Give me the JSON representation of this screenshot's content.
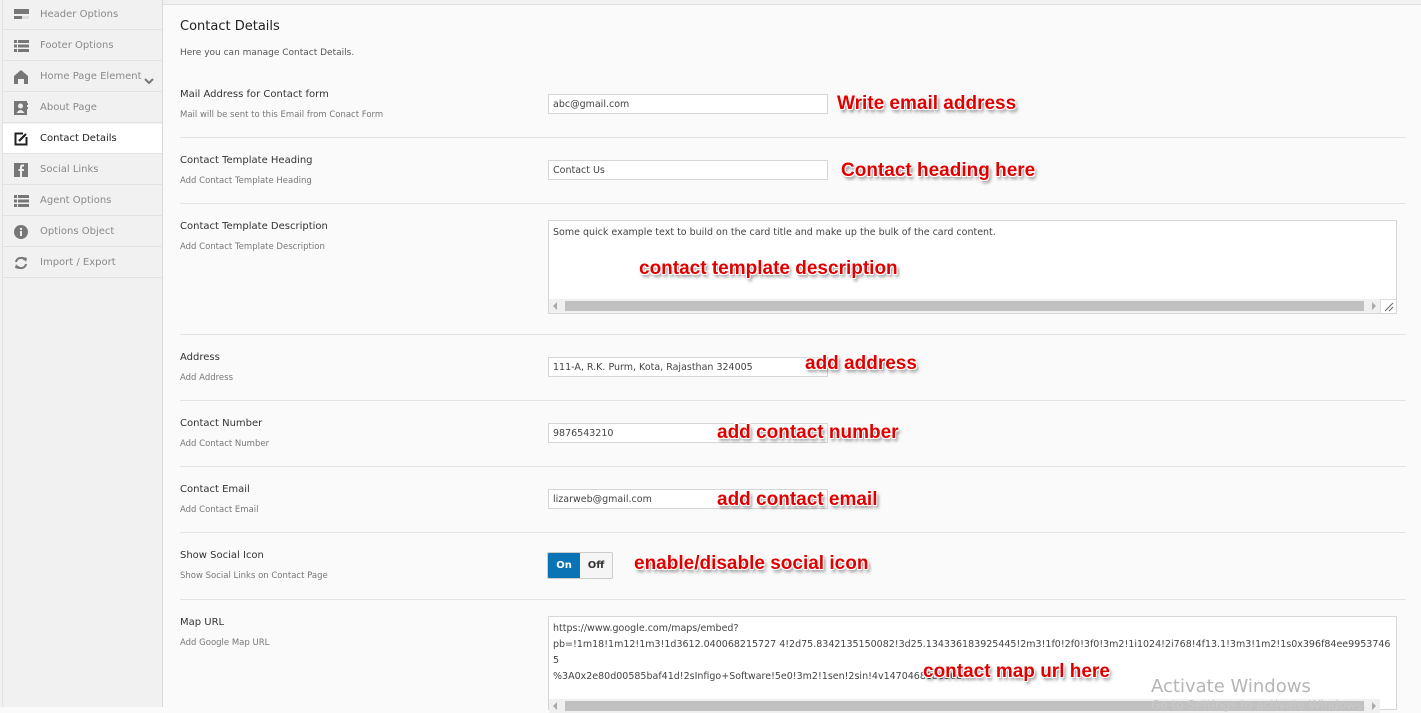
{
  "sidebar": {
    "items": [
      {
        "label": "Header Options",
        "icon": "header-icon"
      },
      {
        "label": "Footer Options",
        "icon": "list-icon"
      },
      {
        "label": "Home Page Element",
        "icon": "home-icon",
        "has_submenu": true
      },
      {
        "label": "About Page",
        "icon": "contact-card-icon"
      },
      {
        "label": "Contact Details",
        "icon": "edit-icon",
        "active": true
      },
      {
        "label": "Social Links",
        "icon": "facebook-icon"
      },
      {
        "label": "Agent Options",
        "icon": "list-icon"
      },
      {
        "label": "Options Object",
        "icon": "info-icon"
      },
      {
        "label": "Import / Export",
        "icon": "refresh-icon"
      }
    ]
  },
  "page": {
    "title": "Contact Details",
    "description": "Here you can manage Contact Details."
  },
  "fields": {
    "mail_address": {
      "label": "Mail Address for Contact form",
      "sub": "Mail will be sent to this Email from Conact Form",
      "value": "abc@gmail.com"
    },
    "template_heading": {
      "label": "Contact Template Heading",
      "sub": "Add Contact Template Heading",
      "value": "Contact Us"
    },
    "template_description": {
      "label": "Contact Template Description",
      "sub": "Add Contact Template Description",
      "value": "Some quick example text to build on the card title and make up the bulk of the card content."
    },
    "address": {
      "label": "Address",
      "sub": "Add Address",
      "value": "111-A, R.K. Purm, Kota, Rajasthan 324005"
    },
    "contact_number": {
      "label": "Contact Number",
      "sub": "Add Contact Number",
      "value": "9876543210"
    },
    "contact_email": {
      "label": "Contact Email",
      "sub": "Add Contact Email",
      "value": "lizarweb@gmail.com"
    },
    "show_social_icon": {
      "label": "Show Social Icon",
      "sub": "Show Social Links on Contact Page",
      "on_label": "On",
      "off_label": "Off",
      "state": "On"
    },
    "map_url": {
      "label": "Map URL",
      "sub": "Add Google Map URL",
      "value": "https://www.google.com/maps/embed?\npb=!1m18!1m12!1m3!1d3612.040068215727 4!2d75.8342135150082!3d25.134336183925445!2m3!1f0!2f0!3f0!3m2!1i1024!2i768!4f13.1!3m3!1m2!1s0x396f84ee99537465\n%3A0x2e80d00585baf41d!2sInfigo+Software!5e0!3m2!1sen!2sin!4v1470468686368"
    }
  },
  "annotations": {
    "mail": "Write email address",
    "heading": "Contact heading here",
    "description": "contact template description",
    "address": "add address",
    "number": "add contact number",
    "email": "add contact email",
    "social": "enable/disable social icon",
    "map": "contact map url here"
  },
  "watermark": {
    "line1": "Activate Windows",
    "line2": "Go to Settings to activate Windows."
  },
  "colors": {
    "toggle_on": "#0a73b5",
    "annotation": "#e00000"
  }
}
